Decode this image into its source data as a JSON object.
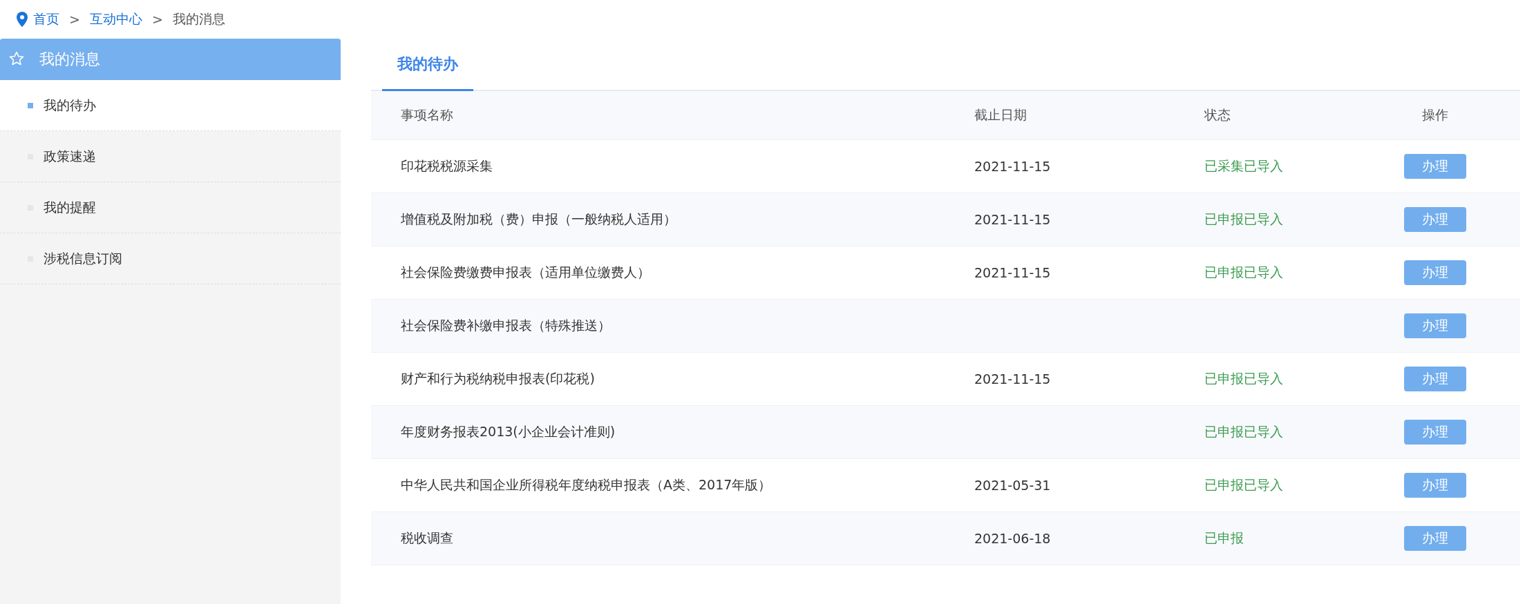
{
  "breadcrumb": [
    {
      "label": "首页",
      "kind": "link"
    },
    {
      "label": "互动中心",
      "kind": "link"
    },
    {
      "label": "我的消息",
      "kind": "current"
    }
  ],
  "breadcrumb_separator": ">",
  "sidebar": {
    "title": "我的消息",
    "items": [
      {
        "label": "我的待办",
        "selected": true
      },
      {
        "label": "政策速递",
        "selected": false
      },
      {
        "label": "我的提醒",
        "selected": false
      },
      {
        "label": "涉税信息订阅",
        "selected": false
      }
    ]
  },
  "tabs": [
    {
      "label": "我的待办",
      "selected": true
    }
  ],
  "table": {
    "columns": [
      "事项名称",
      "截止日期",
      "状态",
      "操作"
    ],
    "rows": [
      {
        "name": "印花税税源采集",
        "deadline": "2021-11-15",
        "status": "已采集已导入",
        "action": "办理"
      },
      {
        "name": "增值税及附加税（费）申报（一般纳税人适用）",
        "deadline": "2021-11-15",
        "status": "已申报已导入",
        "action": "办理"
      },
      {
        "name": "社会保险费缴费申报表（适用单位缴费人）",
        "deadline": "2021-11-15",
        "status": "已申报已导入",
        "action": "办理"
      },
      {
        "name": "社会保险费补缴申报表（特殊推送）",
        "action": "办理"
      },
      {
        "name": "财产和行为税纳税申报表(印花税)",
        "deadline": "2021-11-15",
        "status": "已申报已导入",
        "action": "办理"
      },
      {
        "name": "年度财务报表2013(小企业会计准则)",
        "status": "已申报已导入",
        "action": "办理"
      },
      {
        "name": "中华人民共和国企业所得税年度纳税申报表（A类、2017年版）",
        "deadline": "2021-05-31",
        "status": "已申报已导入",
        "action": "办理"
      },
      {
        "name": "税收调查",
        "deadline": "2021-06-18",
        "status": "已申报",
        "action": "办理"
      }
    ]
  }
}
